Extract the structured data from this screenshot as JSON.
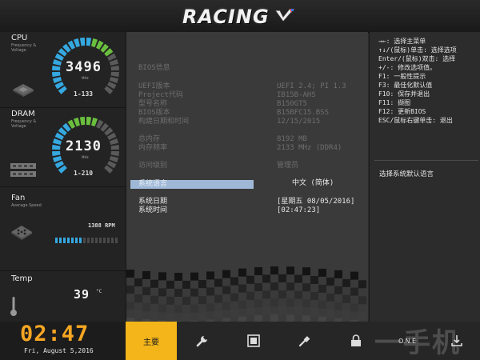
{
  "header": {
    "logo": "RACING"
  },
  "sidebar": {
    "cpu": {
      "title": "CPU",
      "subtitle": "Frequency & Voltage",
      "value": "3496",
      "unit": "MHz",
      "voltage": "1-133",
      "gauge_fraction": 0.7
    },
    "dram": {
      "title": "DRAM",
      "subtitle": "Frequency & Voltage",
      "value": "2130",
      "unit": "MHz",
      "voltage": "1-210",
      "gauge_fraction": 0.55
    },
    "fan": {
      "title": "Fan",
      "subtitle": "Average Speed",
      "rpm": "1388 RPM",
      "bar_fraction": 0.45
    },
    "temp": {
      "title": "Temp",
      "value": "39",
      "unit": "°C"
    }
  },
  "main": {
    "rows": [
      {
        "label": "BIOS信息",
        "value": ""
      },
      {
        "label": "UEFI版本",
        "value": "UEFI 2.4; PI 1.3"
      },
      {
        "label": "Project代码",
        "value": "IB15B-AHS"
      },
      {
        "label": "型号名称",
        "value": "B150GT5"
      },
      {
        "label": "BIOS版本",
        "value": "B15BFC15.BSS"
      },
      {
        "label": "构建日期和时间",
        "value": "12/15/2015"
      },
      {
        "label": "总内存",
        "value": "8192 MB"
      },
      {
        "label": "内存频率",
        "value": "2133 MHz (DDR4)"
      },
      {
        "label": "访问级别",
        "value": "管理员"
      },
      {
        "label": "系统语言",
        "value": "中文 (简体)"
      },
      {
        "label": "系统日期",
        "value": "[星期五 08/05/2016]"
      },
      {
        "label": "系统时间",
        "value": "[02:47:23]"
      }
    ]
  },
  "help": {
    "lines": [
      "→←: 选择主菜单",
      "↑↓/(鼠标)单击: 选择选项",
      "Enter/(鼠标)双击: 选择",
      "+/-: 修改选项值。",
      "F1: 一般性提示",
      "F3: 最佳化默认值",
      "F10: 保存并退出",
      "F11: 撷图",
      "F12: 更新BIOS",
      "ESC/鼠标右键单击: 退出"
    ],
    "description": "选择系统默认语言"
  },
  "footer": {
    "clock": "02:47",
    "date": "Fri,  August  5,2016",
    "nav": [
      {
        "label": "主要",
        "icon": "home-icon"
      },
      {
        "icon": "wrench-icon"
      },
      {
        "icon": "chip-icon"
      },
      {
        "icon": "screwdriver-icon"
      },
      {
        "icon": "lock-icon"
      },
      {
        "label": "O.N.E",
        "icon": "one-icon"
      },
      {
        "icon": "exit-icon"
      }
    ],
    "watermark": "一手机"
  },
  "colors": {
    "accent": "#f4b51a",
    "clock": "#f5a623",
    "gauge_cyan": "#35a8e0",
    "gauge_green": "#6bbf3f",
    "highlight": "#9eb8d6"
  }
}
